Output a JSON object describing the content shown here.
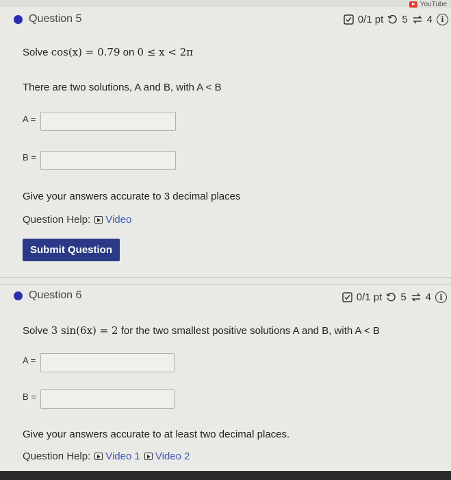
{
  "youtube": {
    "label": "YouTube"
  },
  "q5": {
    "title": "Question 5",
    "points": "0/1 pt",
    "retries": "5",
    "attempts": "4",
    "info": "i",
    "prompt_pre": "Solve ",
    "prompt_math": "cos(x) = 0.79",
    "prompt_mid": " on ",
    "prompt_range": "0 ≤ x < 2π",
    "line2": "There are two solutions, A and B, with A < B",
    "label_a": "A =",
    "label_b": "B =",
    "instructions": "Give your answers accurate to 3 decimal places",
    "help_label": "Question Help:",
    "video_label": "Video",
    "submit_label": "Submit Question"
  },
  "q6": {
    "title": "Question 6",
    "points": "0/1 pt",
    "retries": "5",
    "attempts": "4",
    "info": "i",
    "prompt_pre": "Solve ",
    "prompt_math": "3 sin(6x) = 2",
    "prompt_post": " for the two smallest positive solutions A and B, with A < B",
    "label_a": "A =",
    "label_b": "B =",
    "instructions": "Give your answers accurate to at least two decimal places.",
    "help_label": "Question Help:",
    "video1_label": "Video 1",
    "video2_label": "Video 2"
  },
  "colors": {
    "accent": "#2b3a86",
    "bullet": "#2a2fb0",
    "link": "#3f59b3"
  }
}
